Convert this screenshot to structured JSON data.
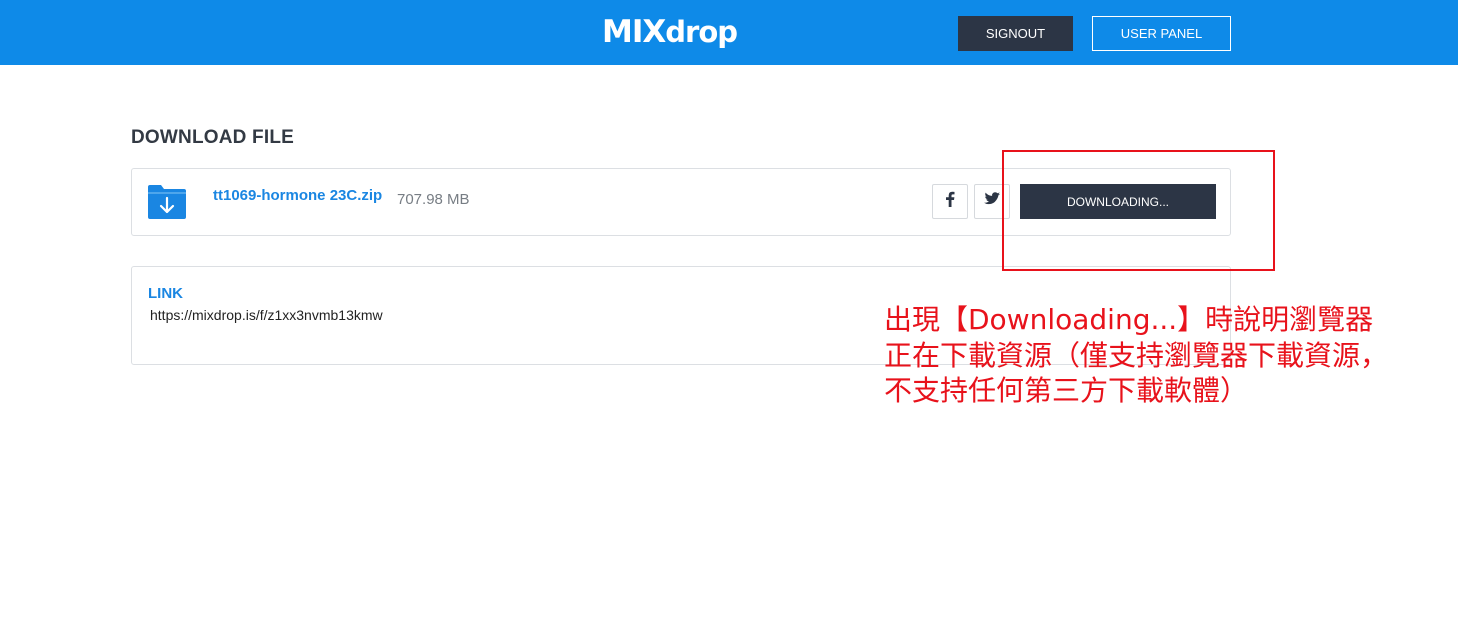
{
  "header": {
    "logo_mix": "MIX",
    "logo_drop": "drop",
    "signout_label": "SIGNOUT",
    "user_panel_label": "USER PANEL",
    "background_color": "#0e8ae8"
  },
  "main": {
    "heading": "DOWNLOAD FILE",
    "file": {
      "name": "tt1069-hormone 23C.zip",
      "size": "707.98 MB",
      "icon": "folder-download-icon"
    },
    "share": {
      "facebook_icon": "facebook-icon",
      "twitter_icon": "twitter-icon"
    },
    "download_button_label": "DOWNLOADING...",
    "link": {
      "label": "LINK",
      "url": "https://mixdrop.is/f/z1xx3nvmb13kmw"
    }
  },
  "annotation": {
    "color": "#e8121b",
    "lines": [
      "出現【Downloading...】時說明瀏覽器",
      "正在下載資源（僅支持瀏覽器下載資源，",
      "不支持任何第三方下載軟體）"
    ]
  }
}
